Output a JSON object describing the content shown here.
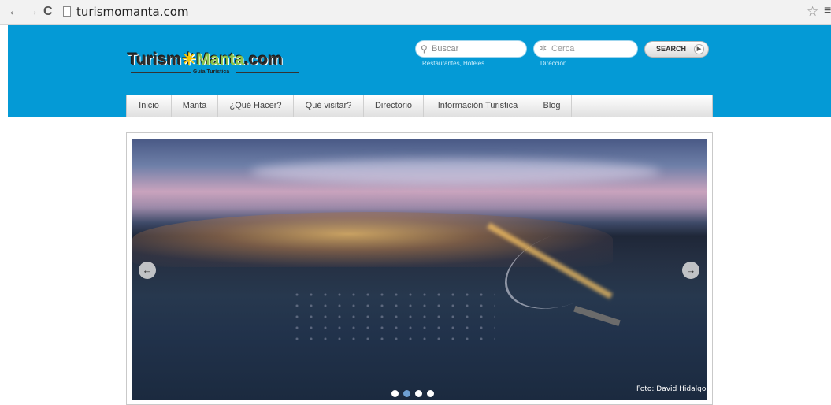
{
  "browser": {
    "url": "turismomanta.com",
    "back_icon": "back-arrow-icon",
    "forward_icon": "forward-arrow-icon",
    "reload_icon": "reload-icon",
    "bookmark_icon": "star-icon",
    "menu_icon": "menu-icon"
  },
  "header": {
    "logo_part1": "Turism",
    "logo_part2": "Manta",
    "logo_part3": ".com",
    "logo_tagline": "Guía Turística",
    "background_color": "#049ad6"
  },
  "search": {
    "query_placeholder": "Buscar",
    "query_hint": "Restaurantes, Hoteles",
    "near_placeholder": "Cerca",
    "near_hint": "Dirección",
    "button_label": "SEARCH"
  },
  "nav": {
    "items": [
      {
        "label": "Inicio"
      },
      {
        "label": "Manta"
      },
      {
        "label": "¿Qué Hacer?"
      },
      {
        "label": "Qué visitar?"
      },
      {
        "label": "Directorio"
      },
      {
        "label": "Información Turistica"
      },
      {
        "label": "Blog"
      }
    ]
  },
  "slider": {
    "credit": "Foto: David Hidalgo",
    "slide_count": 4,
    "active_slide": 2
  }
}
